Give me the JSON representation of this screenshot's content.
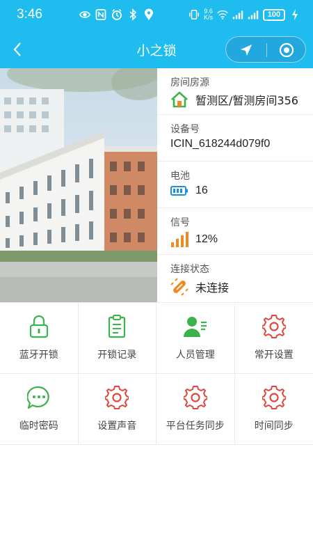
{
  "status_bar": {
    "time": "3:46",
    "net_speed_value": "9.6",
    "net_speed_unit": "K/s",
    "battery": "100"
  },
  "nav": {
    "title": "小之锁"
  },
  "details": {
    "room": {
      "label": "房间房源",
      "value": "暂测区/暂测房间356",
      "icon": "house-icon"
    },
    "device": {
      "label": "设备号",
      "value": "ICIN_618244d079f0"
    },
    "battery": {
      "label": "电池",
      "value": "16",
      "icon": "battery-icon"
    },
    "signal": {
      "label": "信号",
      "value": "12%",
      "icon": "signal-bars-icon"
    },
    "connection": {
      "label": "连接状态",
      "value": "未连接",
      "icon": "disconnected-plug-icon"
    }
  },
  "actions": [
    {
      "label": "蓝牙开锁",
      "icon": "lock-icon",
      "color": "#3cb34a"
    },
    {
      "label": "开锁记录",
      "icon": "clipboard-icon",
      "color": "#3cb34a"
    },
    {
      "label": "人员管理",
      "icon": "user-manage-icon",
      "color": "#3cb34a"
    },
    {
      "label": "常开设置",
      "icon": "gear-icon",
      "color": "#e0473c"
    },
    {
      "label": "临时密码",
      "icon": "chat-bubble-icon",
      "color": "#3cb34a"
    },
    {
      "label": "设置声音",
      "icon": "gear-icon",
      "color": "#e0473c"
    },
    {
      "label": "平台任务同步",
      "icon": "gear-icon",
      "color": "#e0473c"
    },
    {
      "label": "时间同步",
      "icon": "gear-icon",
      "color": "#e0473c"
    }
  ],
  "colors": {
    "header": "#1ebcef",
    "green": "#3cb34a",
    "red": "#e0473c",
    "orange": "#f08a1e"
  }
}
